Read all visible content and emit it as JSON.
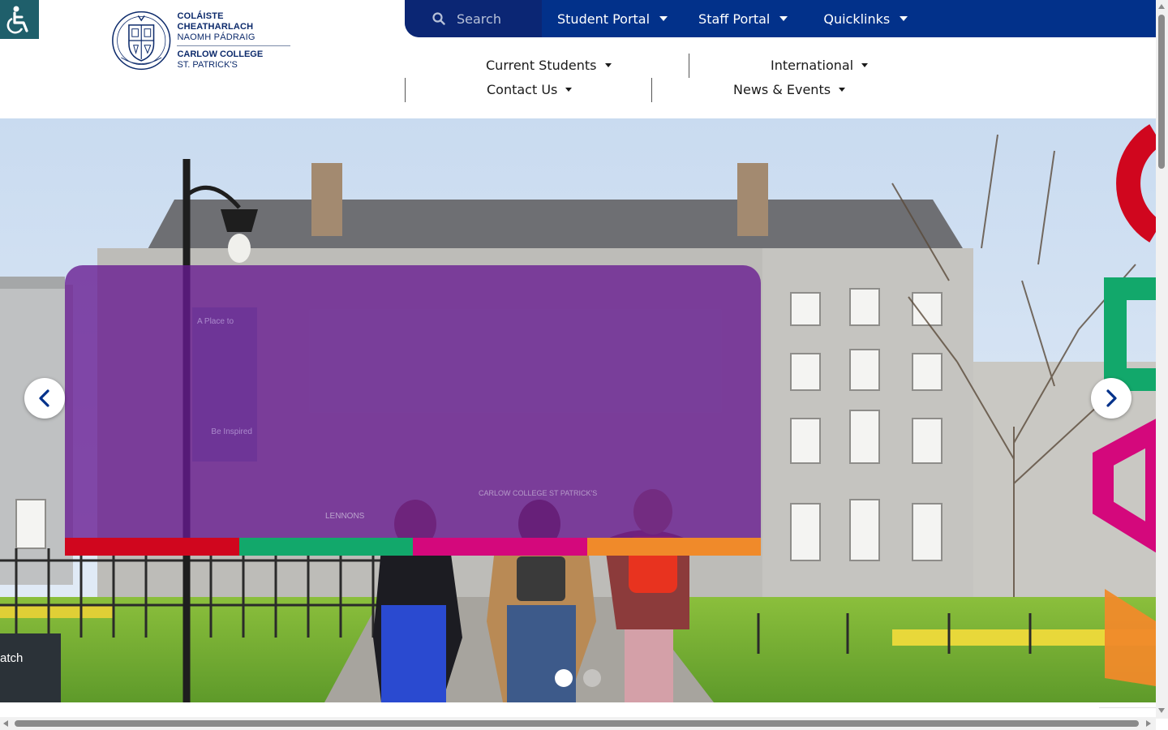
{
  "accessibility": {
    "icon": "wheelchair-icon"
  },
  "logo": {
    "line1": "COLÁISTE CHEATHARLACH",
    "line2": "NAOMH PÁDRAIG",
    "line3": "CARLOW COLLEGE",
    "line4": "ST. PATRICK'S"
  },
  "topbar": {
    "search_placeholder": "Search",
    "links": [
      {
        "label": "Student Portal"
      },
      {
        "label": "Staff Portal"
      },
      {
        "label": "Quicklinks"
      }
    ]
  },
  "subnav": {
    "items": [
      {
        "label": "Current Students"
      },
      {
        "label": "International"
      },
      {
        "label": "Contact Us"
      },
      {
        "label": "News & Events"
      }
    ]
  },
  "hero": {
    "slide_count": 2,
    "active_slide": 1,
    "accent_colors": [
      "#d0061e",
      "#12a86b",
      "#d4087c",
      "#f08a2a"
    ],
    "card_color": "#661a91",
    "banner_text_1": "A Place to",
    "banner_text_2": "Be Inspired",
    "building_sign_1": "LENNONS",
    "building_sign_2": "CARLOW COLLEGE ST PATRICK'S",
    "bin_text": "atch"
  },
  "colors": {
    "topbar": "#02318a",
    "search_bg": "#0b2674",
    "a11y_bg": "#1f5f6b",
    "logo_text": "#0c2a6b"
  }
}
